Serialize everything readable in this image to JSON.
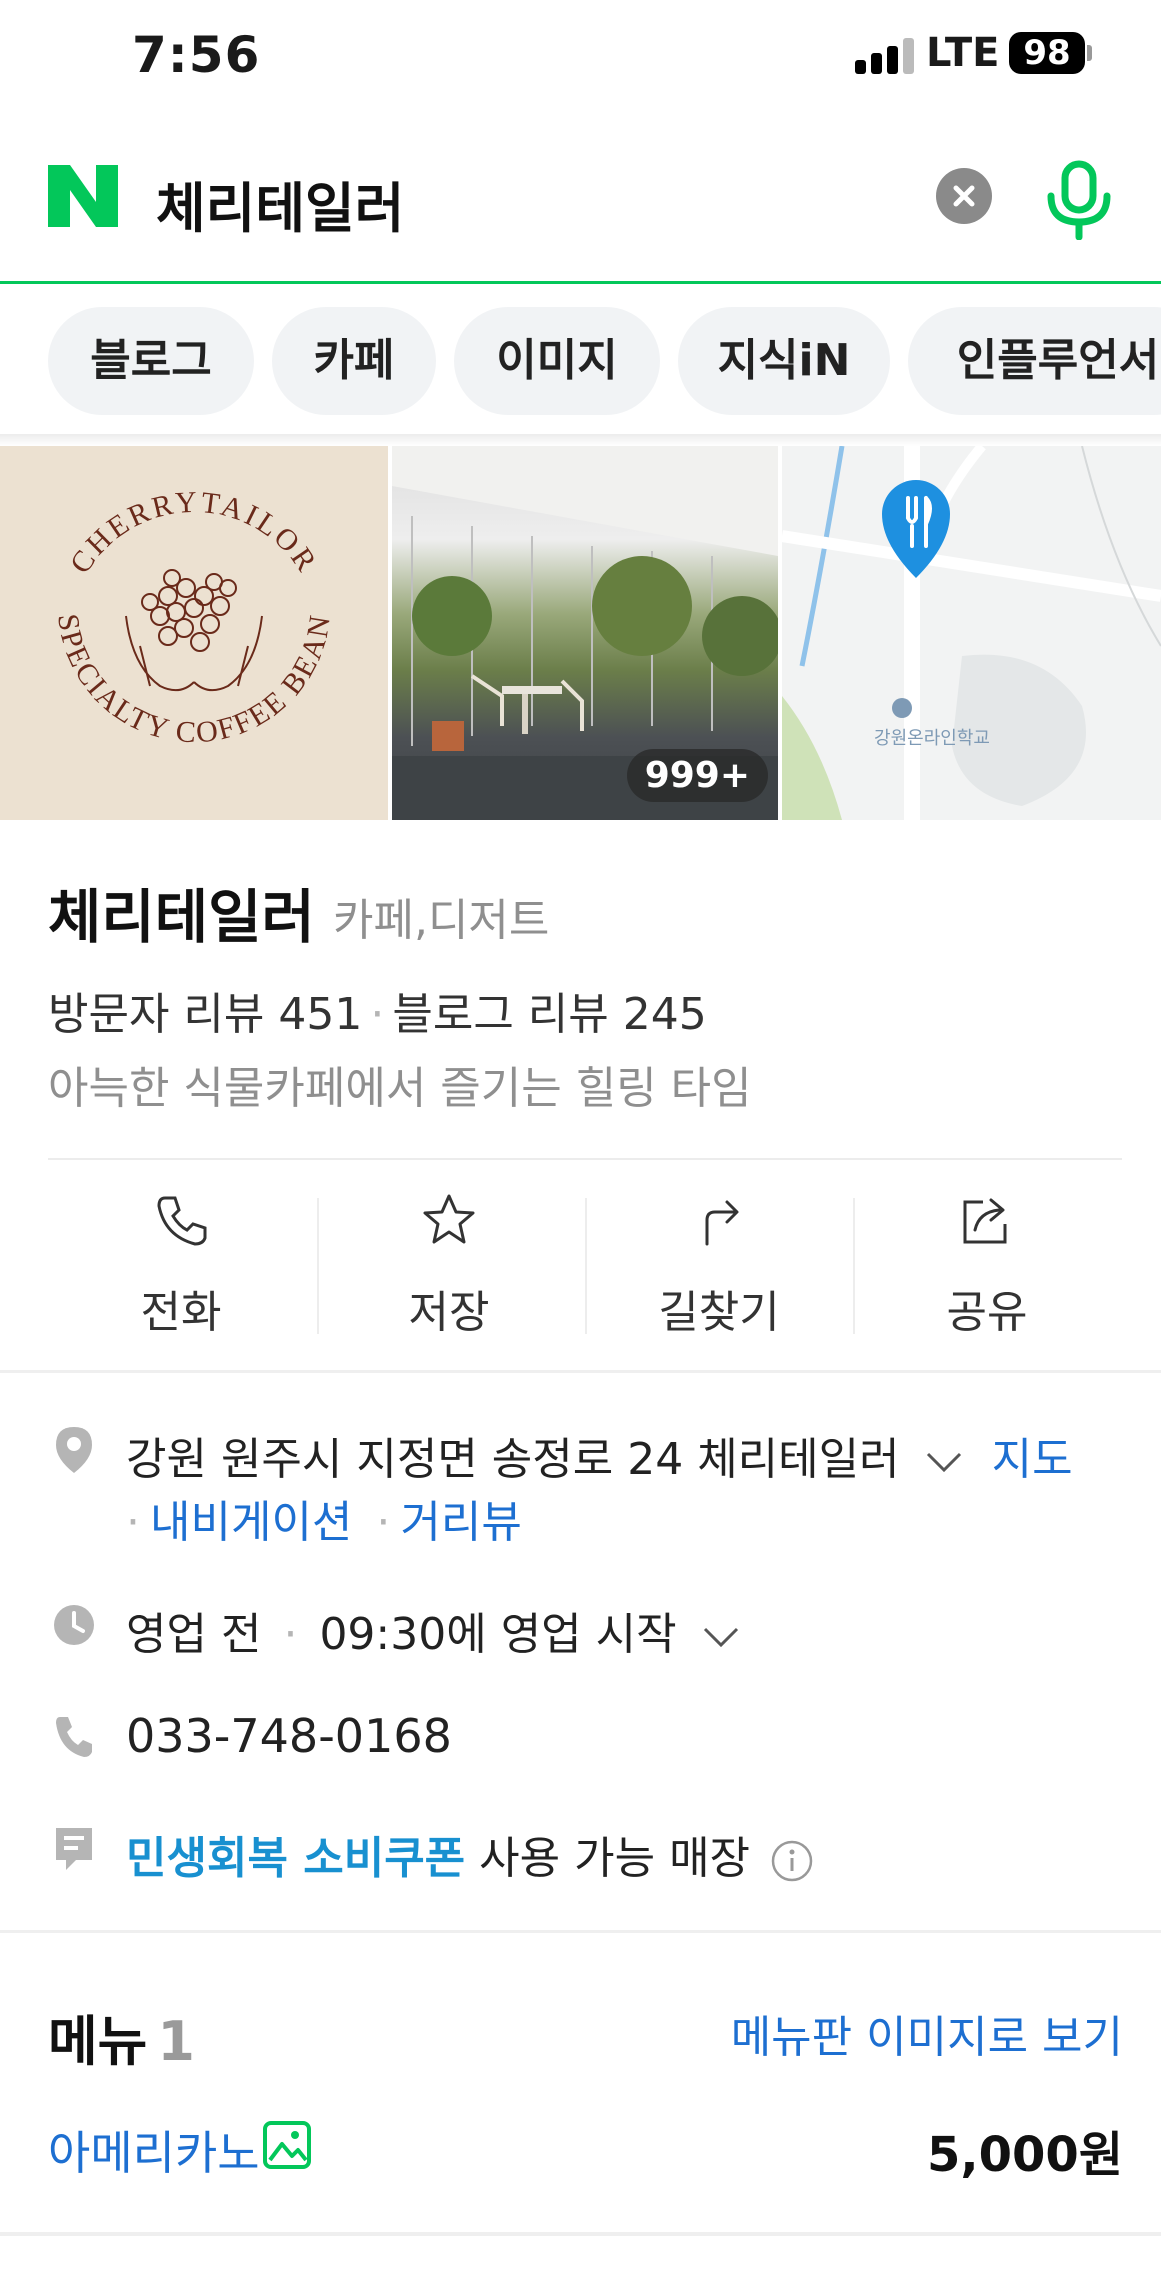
{
  "status_bar": {
    "time": "7:56",
    "network": "LTE",
    "battery": "98"
  },
  "search": {
    "query": "체리테일러"
  },
  "tabs": [
    {
      "label": "블로그"
    },
    {
      "label": "카페"
    },
    {
      "label": "이미지"
    },
    {
      "label": "지식iN"
    },
    {
      "label": "인플루언서"
    }
  ],
  "photos": {
    "logo_text": "CHERRYTAILOR SPECIALTY COFFEE BEAN",
    "count_badge": "999+",
    "map_label": "강원온라인학교"
  },
  "place": {
    "name": "체리테일러",
    "category": "카페,디저트",
    "visitor_reviews": "방문자 리뷰 451",
    "blog_reviews": "블로그 리뷰 245",
    "description": "아늑한 식물카페에서 즐기는 힐링 타임"
  },
  "actions": [
    {
      "label": "전화",
      "icon": "phone-icon"
    },
    {
      "label": "저장",
      "icon": "star-icon"
    },
    {
      "label": "길찾기",
      "icon": "directions-icon"
    },
    {
      "label": "공유",
      "icon": "share-icon"
    }
  ],
  "details": {
    "address": "강원 원주시 지정면 송정로 24 체리테일러",
    "map_link": "지도",
    "navigation_link": "내비게이션",
    "streetview_link": "거리뷰",
    "hours_status": "영업 전",
    "hours_start": "09:30에 영업 시작",
    "phone": "033-748-0168",
    "coupon_link": "민생회복 소비쿠폰",
    "coupon_text": "사용 가능 매장"
  },
  "menu": {
    "title": "메뉴",
    "count": "1",
    "image_link": "메뉴판 이미지로 보기",
    "items": [
      {
        "name": "아메리카노",
        "price": "5,000원"
      }
    ]
  },
  "colors": {
    "naver_green": "#03c75a",
    "link_blue": "#1d6fd1",
    "map_pin": "#1e90e0"
  }
}
